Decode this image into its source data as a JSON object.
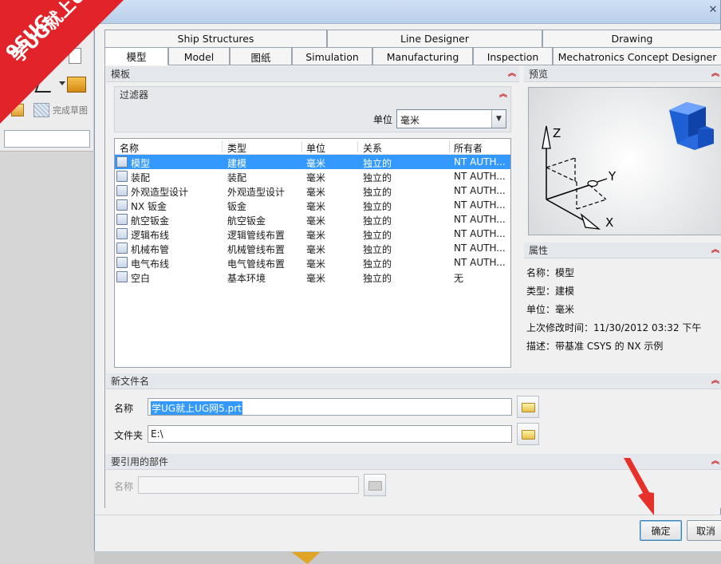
{
  "watermark": {
    "line1": "9SUG",
    "line2": "学UG就上UG网"
  },
  "background": {
    "command_label": "完成草图"
  },
  "tabs_row1": [
    "Ship Structures",
    "Line Designer",
    "Drawing"
  ],
  "tabs_row2": [
    "模型",
    "Model",
    "图纸",
    "Simulation",
    "Manufacturing",
    "Inspection",
    "Mechatronics Concept Designer"
  ],
  "template_group": {
    "title": "模板",
    "filter": {
      "title": "过滤器",
      "unit_label": "单位",
      "unit_value": "毫米"
    },
    "columns": [
      "名称",
      "类型",
      "单位",
      "关系",
      "所有者"
    ],
    "rows": [
      {
        "name": "模型",
        "type": "建模",
        "unit": "毫米",
        "relation": "独立的",
        "owner": "NT AUTH...",
        "icon": "model-icon",
        "selected": true
      },
      {
        "name": "装配",
        "type": "装配",
        "unit": "毫米",
        "relation": "独立的",
        "owner": "NT AUTH...",
        "icon": "assembly-icon"
      },
      {
        "name": "外观造型设计",
        "type": "外观造型设计",
        "unit": "毫米",
        "relation": "独立的",
        "owner": "NT AUTH...",
        "icon": "shape-studio-icon"
      },
      {
        "name": "NX 钣金",
        "type": "钣金",
        "unit": "毫米",
        "relation": "独立的",
        "owner": "NT AUTH...",
        "icon": "sheet-metal-icon"
      },
      {
        "name": "航空钣金",
        "type": "航空钣金",
        "unit": "毫米",
        "relation": "独立的",
        "owner": "NT AUTH...",
        "icon": "aero-sheet-metal-icon"
      },
      {
        "name": "逻辑布线",
        "type": "逻辑管线布置",
        "unit": "毫米",
        "relation": "独立的",
        "owner": "NT AUTH...",
        "icon": "logical-routing-icon"
      },
      {
        "name": "机械布管",
        "type": "机械管线布置",
        "unit": "毫米",
        "relation": "独立的",
        "owner": "NT AUTH...",
        "icon": "mechanical-routing-icon"
      },
      {
        "name": "电气布线",
        "type": "电气管线布置",
        "unit": "毫米",
        "relation": "独立的",
        "owner": "NT AUTH...",
        "icon": "electrical-routing-icon"
      },
      {
        "name": "空白",
        "type": "基本环境",
        "unit": "毫米",
        "relation": "独立的",
        "owner": "无",
        "icon": "blank-icon"
      }
    ]
  },
  "preview_group": {
    "title": "预览",
    "axis_x": "X",
    "axis_y": "Y",
    "axis_z": "Z"
  },
  "properties_group": {
    "title": "属性",
    "items": [
      {
        "label": "名称：",
        "value": "模型"
      },
      {
        "label": "类型：",
        "value": "建模"
      },
      {
        "label": "单位：",
        "value": "毫米"
      },
      {
        "label": "上次修改时间：",
        "value": "11/30/2012 03:32 下午"
      },
      {
        "label": "描述：",
        "value": "带基准 CSYS 的 NX 示例"
      }
    ]
  },
  "new_file_group": {
    "title": "新文件名",
    "name_label": "名称",
    "name_value": "学UG就上UG网5.prt",
    "folder_label": "文件夹",
    "folder_value": "E:\\"
  },
  "ref_part_group": {
    "title": "要引用的部件",
    "name_label": "名称",
    "name_value": ""
  },
  "buttons": {
    "ok": "确定",
    "cancel": "取消"
  },
  "colors": {
    "selection": "#3399ff",
    "header_chevron": "#c81e1e",
    "annotation_arrow": "#e8302a"
  }
}
